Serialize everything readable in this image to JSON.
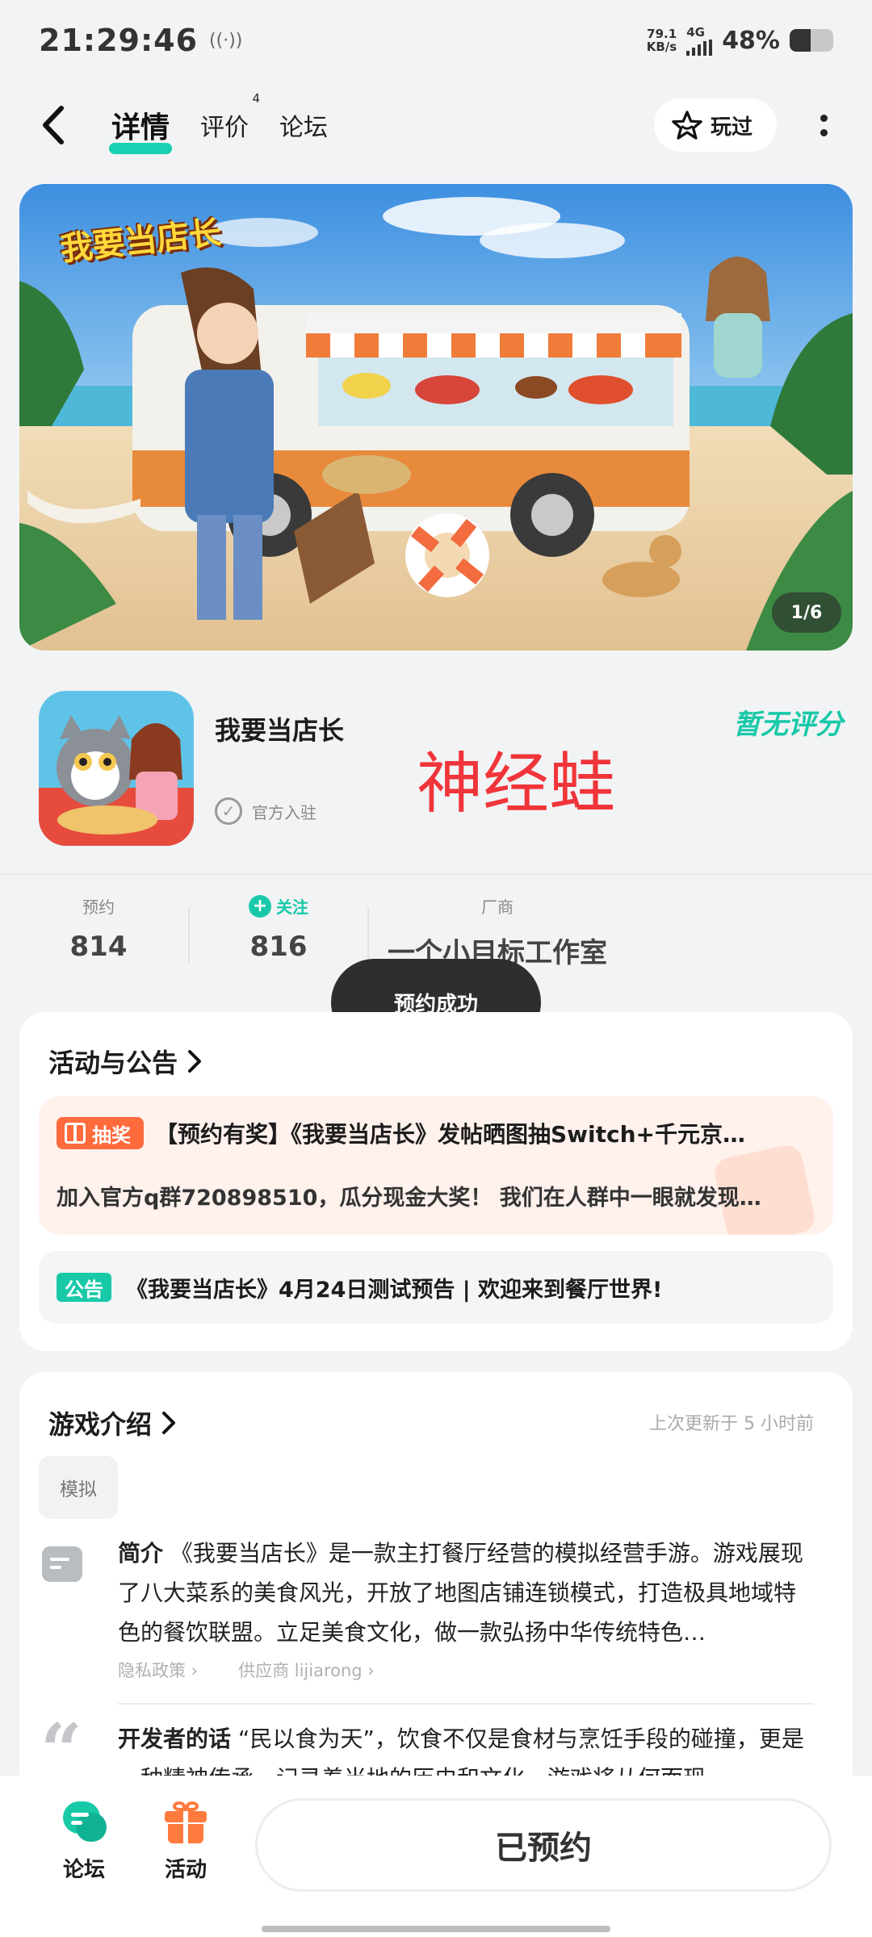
{
  "status_bar": {
    "time": "21:29:46",
    "speed_value": "79.1",
    "speed_unit": "KB/s",
    "network": "4G",
    "battery_text": "48%",
    "battery_level": 0.48
  },
  "nav": {
    "tabs": [
      {
        "label": "详情",
        "active": true
      },
      {
        "label": "评价",
        "badge": "4"
      },
      {
        "label": "论坛"
      }
    ],
    "played_label": "玩过"
  },
  "banner": {
    "logo_text": "我要当店长",
    "counter": "1/6"
  },
  "app": {
    "name": "我要当店长",
    "official_label": "官方入驻",
    "rating_text": "暂无评分",
    "overlay_text": "神经蛙"
  },
  "stats": {
    "reserve_label": "预约",
    "reserve_value": "814",
    "follow_label": "关注",
    "follow_value": "816",
    "vendor_label": "厂商",
    "vendor_value": "一个小目标工作室"
  },
  "toast": "预约成功",
  "activity": {
    "title": "活动与公告",
    "lottery_badge": "抽奖",
    "lottery_title": "【预约有奖】《我要当店长》发帖晒图抽Switch+千元京…",
    "lottery_desc": "加入官方q群720898510，瓜分现金大奖！ 我们在人群中一眼就发现…",
    "notice_badge": "公告",
    "notice_text": "《我要当店长》4月24日测试预告 | 欢迎来到餐厅世界!"
  },
  "intro": {
    "title": "游戏介绍",
    "updated": "上次更新于 5 小时前",
    "genre_tag": "模拟",
    "desc_label": "简介",
    "desc_text": "《我要当店长》是一款主打餐厅经营的模拟经营手游。游戏展现了八大菜系的美食风光，开放了地图店铺连锁模式，打造极具地域特色的餐饮联盟。立足美食文化，做一款弘扬中华传统特色…",
    "privacy_link": "隐私政策",
    "supplier_link": "供应商 lijiarong",
    "dev_label": "开发者的话",
    "dev_text": "“民以食为天”，饮食不仅是食材与烹饪手段的碰撞，更是一种精神传承，记录着当地的历史和文化。游戏将从何而现…"
  },
  "bottom_bar": {
    "forum_label": "论坛",
    "activity_label": "活动",
    "reserved_label": "已预约"
  },
  "colors": {
    "accent": "#18c9a8",
    "overlay_red": "#f0353a",
    "lottery_orange": "#ff6b3d"
  }
}
